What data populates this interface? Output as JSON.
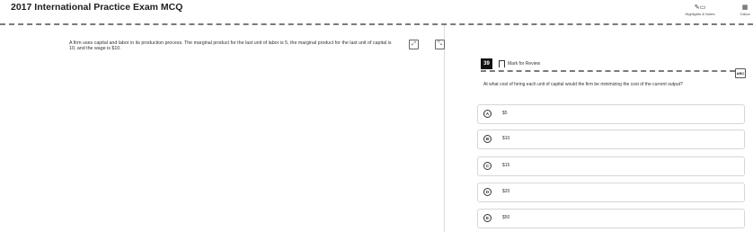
{
  "header": {
    "title": "2017 International Practice Exam MCQ",
    "tools": [
      {
        "label": "Highlights & Notes",
        "icon": "highlighter-icon"
      },
      {
        "label": "Calcul",
        "icon": "calculator-icon"
      }
    ]
  },
  "passage": {
    "text": "A firm uses capital and labor in its production process. The marginal product for the last unit of labor is 5, the marginal product for the last unit of capital is 10, and the wage is $10."
  },
  "question": {
    "number": "39",
    "mark_for_review": "Mark for Review",
    "abc_label": "ABC",
    "stem": "At what cost of hiring each unit of capital would the firm be minimizing the cost of the current output?",
    "choices": [
      {
        "letter": "A",
        "text": "$5"
      },
      {
        "letter": "B",
        "text": "$10"
      },
      {
        "letter": "C",
        "text": "$15"
      },
      {
        "letter": "D",
        "text": "$20"
      },
      {
        "letter": "E",
        "text": "$50"
      }
    ]
  }
}
